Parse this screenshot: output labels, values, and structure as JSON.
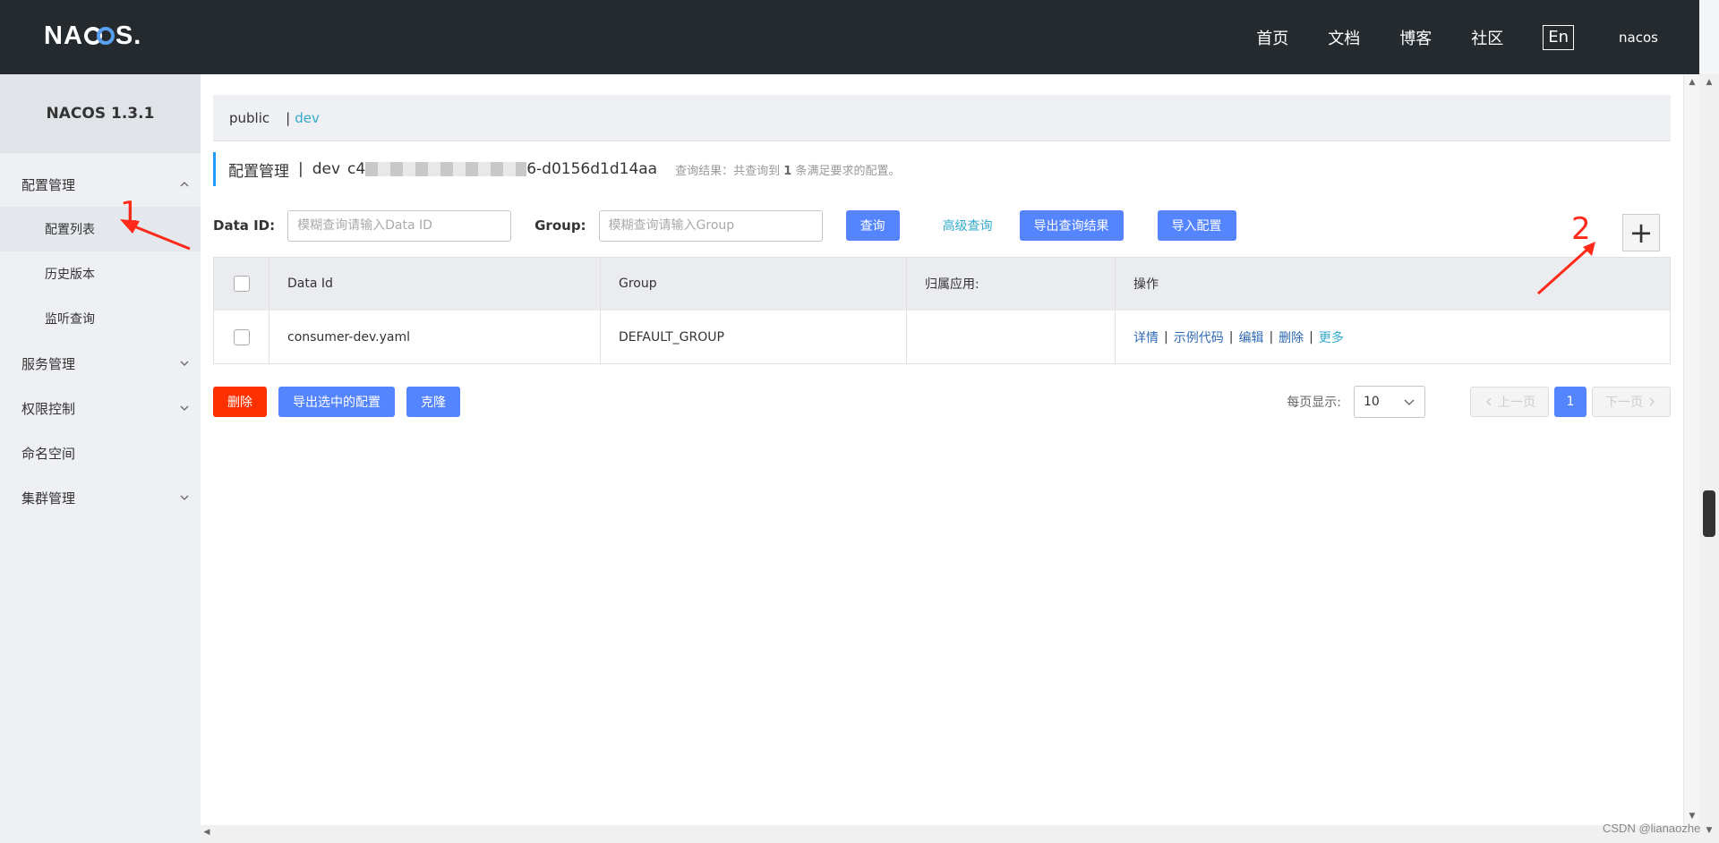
{
  "header": {
    "logo": "NACOS",
    "nav": [
      "首页",
      "文档",
      "博客",
      "社区"
    ],
    "lang": "En",
    "user": "nacos"
  },
  "sidebar": {
    "version": "NACOS 1.3.1",
    "items": [
      {
        "label": "配置管理"
      },
      {
        "label": "配置列表"
      },
      {
        "label": "历史版本"
      },
      {
        "label": "监听查询"
      },
      {
        "label": "服务管理"
      },
      {
        "label": "权限控制"
      },
      {
        "label": "命名空间"
      },
      {
        "label": "集群管理"
      }
    ]
  },
  "namespaces": {
    "public": "public",
    "dev": "dev"
  },
  "title": {
    "prefix": "配置管理",
    "sep": "|",
    "ns": "dev",
    "id_start": "c4",
    "id_end": "6-d0156d1d14aa",
    "result_prefix": "查询结果：共查询到",
    "result_count": "1",
    "result_suffix": "条满足要求的配置。"
  },
  "search": {
    "dataid_label": "Data ID:",
    "dataid_placeholder": "模糊查询请输入Data ID",
    "group_label": "Group:",
    "group_placeholder": "模糊查询请输入Group",
    "query": "查询",
    "advanced": "高级查询",
    "export": "导出查询结果",
    "import": "导入配置",
    "add": "+"
  },
  "table": {
    "headers": [
      "Data Id",
      "Group",
      "归属应用:",
      "操作"
    ],
    "rows": [
      {
        "dataid": "consumer-dev.yaml",
        "group": "DEFAULT_GROUP",
        "app": "",
        "ops": [
          "详情",
          "示例代码",
          "编辑",
          "删除",
          "更多"
        ]
      }
    ]
  },
  "actions": {
    "delete": "删除",
    "export_selected": "导出选中的配置",
    "clone": "克隆"
  },
  "pager": {
    "page_size_label": "每页显示:",
    "page_size": "10",
    "prev": "上一页",
    "next": "下一页",
    "current": "1"
  },
  "annotations": {
    "one": "1",
    "two": "2"
  },
  "watermark": "CSDN @lianaozhe",
  "colors": {
    "topbar": "#252a2f",
    "primary": "#5584ff",
    "danger": "#ff3000",
    "link": "#33aacc"
  }
}
